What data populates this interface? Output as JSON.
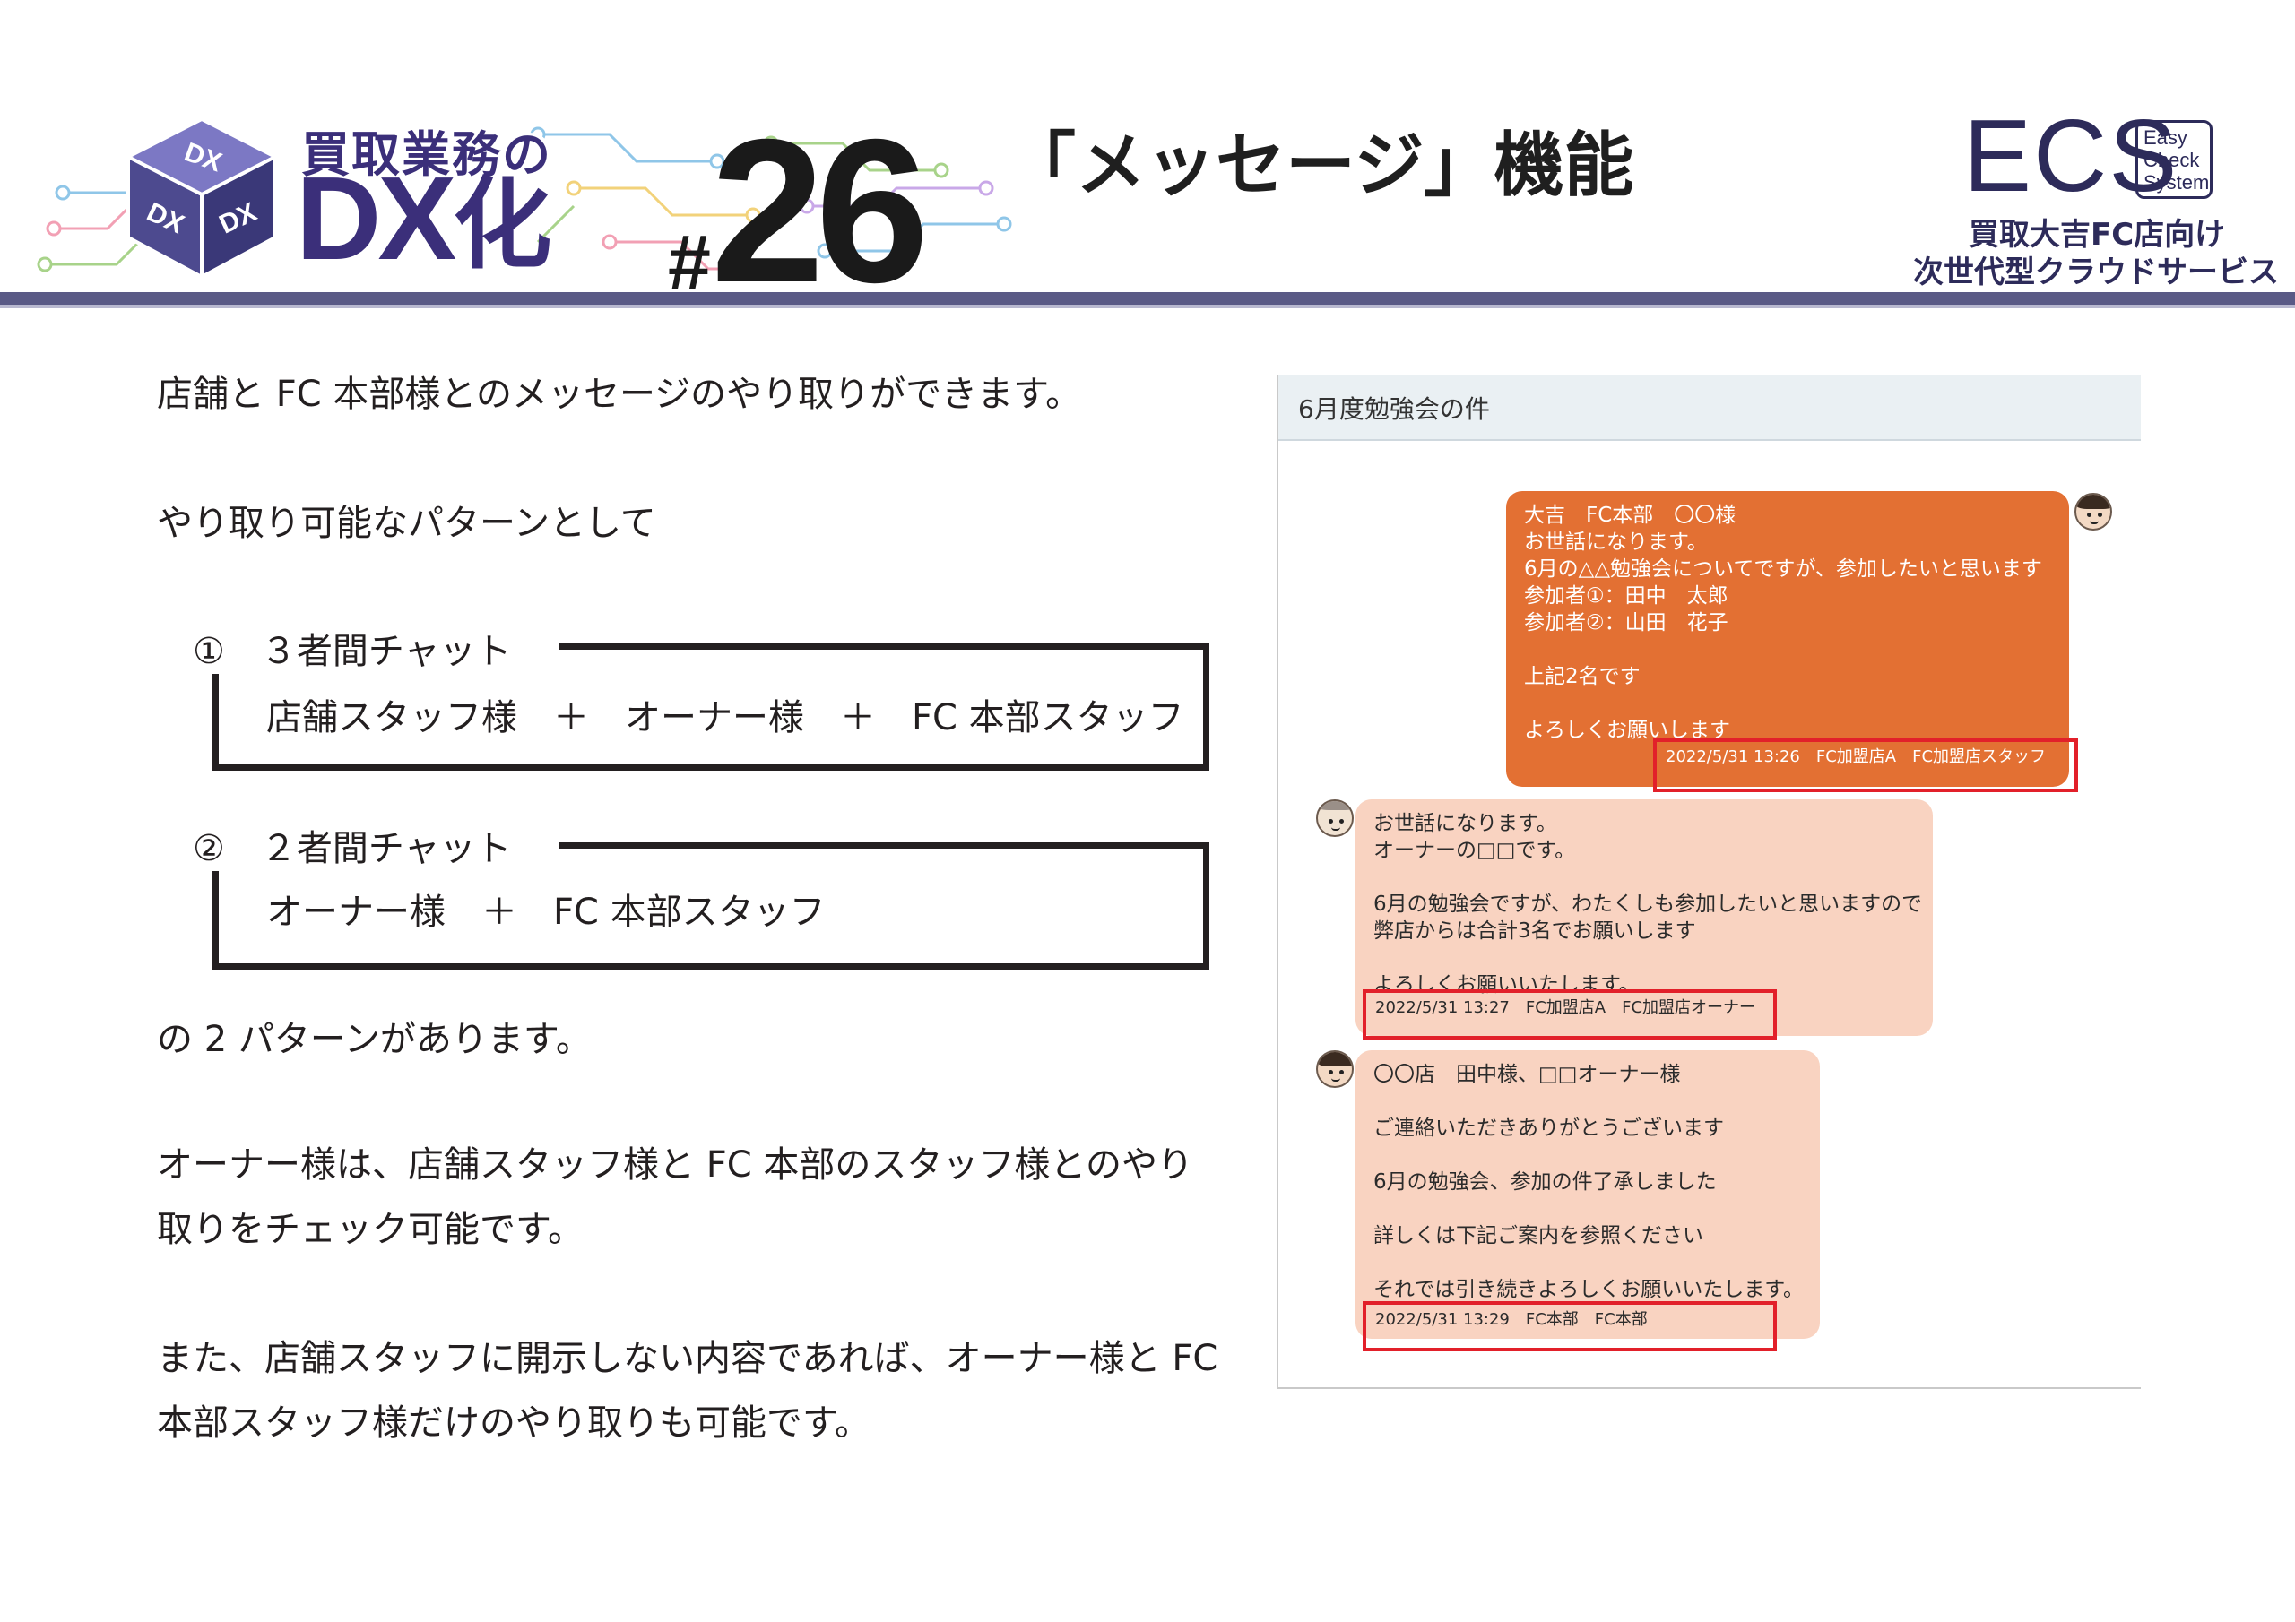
{
  "header": {
    "logo_top": "買取業務の",
    "logo_big": "DX",
    "logo_big_suffix": "化",
    "cube_labels": [
      "DX",
      "DX",
      "DX"
    ],
    "episode_hash": "#",
    "episode_number": "26",
    "title": "「メッセージ」機能",
    "ecs": {
      "letters": "ECS",
      "box_lines": [
        "Easy",
        "Check",
        "System"
      ],
      "subtitle_line1": "買取大吉FC店向け",
      "subtitle_line2": "次世代型クラウドサービス"
    },
    "colors": {
      "brand_navy": "#3b2f7a",
      "rule": "#5a5a86"
    }
  },
  "body": {
    "intro": "店舗と FC 本部様とのメッセージのやり取りができます。",
    "patterns_lead": "やり取り可能なパターンとして",
    "patterns": [
      {
        "head": "①　３者間チャット",
        "members": "店舗スタッフ様　＋　オーナー様　＋　FC 本部スタッフ"
      },
      {
        "head": "②　２者間チャット",
        "members": "オーナー様　＋　FC 本部スタッフ"
      }
    ],
    "patterns_tail": "の 2 パターンがあります。",
    "owner_note": [
      "オーナー様は、店舗スタッフ様と FC 本部のスタッフ様とのやり",
      "取りをチェック可能です。"
    ],
    "private_note": [
      "また、店舗スタッフに開示しない内容であれば、オーナー様と FC",
      "本部スタッフ様だけのやり取りも可能です。"
    ]
  },
  "chat": {
    "thread_title": "6月度勉強会の件",
    "messages": [
      {
        "lines": [
          "大吉　FC本部　〇〇様",
          "お世話になります。",
          "6月の△△勉強会についてですが、参加したいと思います",
          "参加者①：田中　太郎",
          "参加者②：山田　花子",
          "",
          "上記2名です",
          "",
          "よろしくお願いします"
        ],
        "meta": "2022/5/31 13:26　FC加盟店A　FC加盟店スタッフ"
      },
      {
        "lines": [
          "お世話になります。",
          "オーナーの□□です。",
          "",
          "6月の勉強会ですが、わたくしも参加したいと思いますので",
          "弊店からは合計3名でお願いします",
          "",
          "よろしくお願いいたします。"
        ],
        "meta": "2022/5/31 13:27　FC加盟店A　FC加盟店オーナー"
      },
      {
        "lines": [
          "〇〇店　田中様、□□オーナー様",
          "",
          "ご連絡いただきありがとうございます",
          "",
          "6月の勉強会、参加の件了承しました",
          "",
          "詳しくは下記ご案内を参照ください",
          "",
          "それでは引き続きよろしくお願いいたします。"
        ],
        "meta": "2022/5/31 13:29　FC本部　FC本部"
      }
    ],
    "colors": {
      "staff_bubble": "#e37033",
      "other_bubble": "#f9d3c1",
      "highlight": "#e2202a"
    }
  }
}
